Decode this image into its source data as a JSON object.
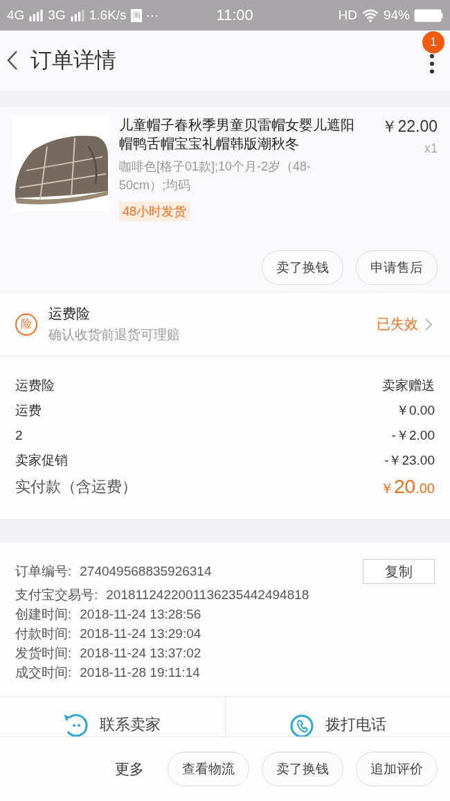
{
  "status_bar": {
    "left": [
      "4G",
      "3G",
      "1.6K/s",
      "淘",
      "···"
    ],
    "time": "11:00",
    "hd": "HD",
    "battery": "94%"
  },
  "header": {
    "title": "订单详情",
    "badge": "1"
  },
  "product": {
    "title": "儿童帽子春秋季男童贝雷帽女婴儿遮阳帽鸭舌帽宝宝礼帽韩版潮秋冬",
    "price": "￥22.00",
    "qty": "x1",
    "sku": "咖啡色[格子01款];10个月-2岁（48-50cm）;均码",
    "tag": "48小时发货",
    "buttons": [
      "卖了换钱",
      "申请售后"
    ]
  },
  "insurance": {
    "icon": "险",
    "title": "运费险",
    "subtitle": "确认收货前退货可理赔",
    "status": "已失效"
  },
  "fees": [
    {
      "label": "运费险",
      "value": "卖家赠送",
      "kind": "plain"
    },
    {
      "label": "运费",
      "value": "￥0.00",
      "kind": "plain"
    },
    {
      "label": "2",
      "value": "-￥2.00",
      "kind": "plain"
    },
    {
      "label": "卖家促销",
      "value": "-￥23.00",
      "kind": "plain"
    },
    {
      "label": "实付款（含运费）",
      "currency": "￥",
      "value": "20",
      "cents": ".00",
      "kind": "total"
    }
  ],
  "order_info": [
    {
      "label": "订单编号:",
      "value": "274049568835926314",
      "copy": "复制"
    },
    {
      "label": "支付宝交易号:",
      "value": "2018112422001136235442494818"
    },
    {
      "label": "创建时间:",
      "value": "2018-11-24 13:28:56"
    },
    {
      "label": "付款时间:",
      "value": "2018-11-24 13:29:04"
    },
    {
      "label": "发货时间:",
      "value": "2018-11-24 13:37:02"
    },
    {
      "label": "成交时间:",
      "value": "2018-11-28 19:11:14"
    }
  ],
  "contact": [
    {
      "kind": "chat",
      "label": "联系卖家"
    },
    {
      "kind": "phone",
      "label": "拨打电话"
    }
  ],
  "bottom_bar": {
    "more": "更多",
    "buttons": [
      "查看物流",
      "卖了换钱",
      "追加评价"
    ]
  }
}
